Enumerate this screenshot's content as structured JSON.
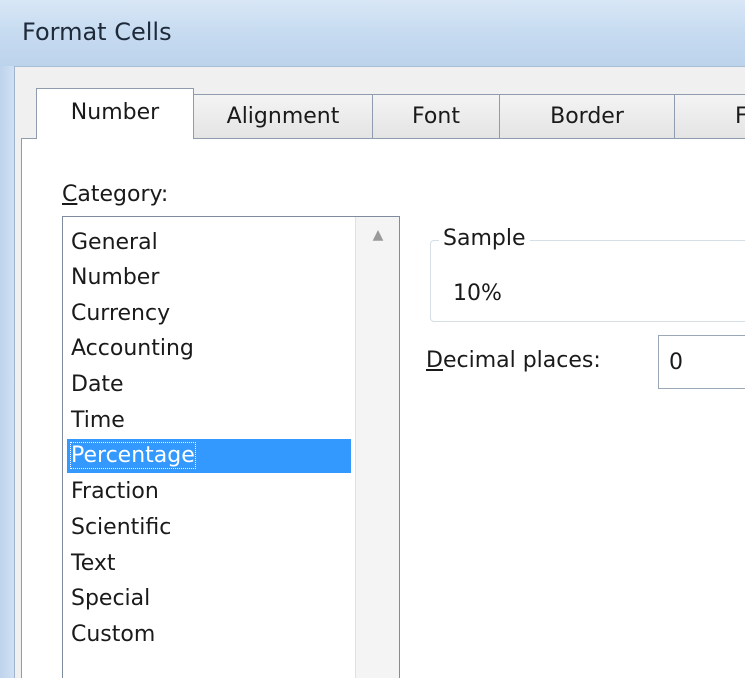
{
  "window": {
    "title": "Format Cells"
  },
  "tabs": [
    {
      "label": "Number",
      "active": true
    },
    {
      "label": "Alignment",
      "active": false
    },
    {
      "label": "Font",
      "active": false
    },
    {
      "label": "Border",
      "active": false
    },
    {
      "label": "F",
      "active": false
    }
  ],
  "category": {
    "label_mnemonic": "C",
    "label_rest": "ategory:",
    "items": [
      "General",
      "Number",
      "Currency",
      "Accounting",
      "Date",
      "Time",
      "Percentage",
      "Fraction",
      "Scientific",
      "Text",
      "Special",
      "Custom"
    ],
    "selected": "Percentage"
  },
  "sample": {
    "legend": "Sample",
    "value": "10%"
  },
  "decimal_places": {
    "label_mnemonic": "D",
    "label_rest": "ecimal places:",
    "value": "0"
  },
  "icons": {
    "scroll_up": "scroll-up-arrow-icon"
  },
  "colors": {
    "selection": "#3399ff",
    "titlebar": "#c8dcf1"
  }
}
